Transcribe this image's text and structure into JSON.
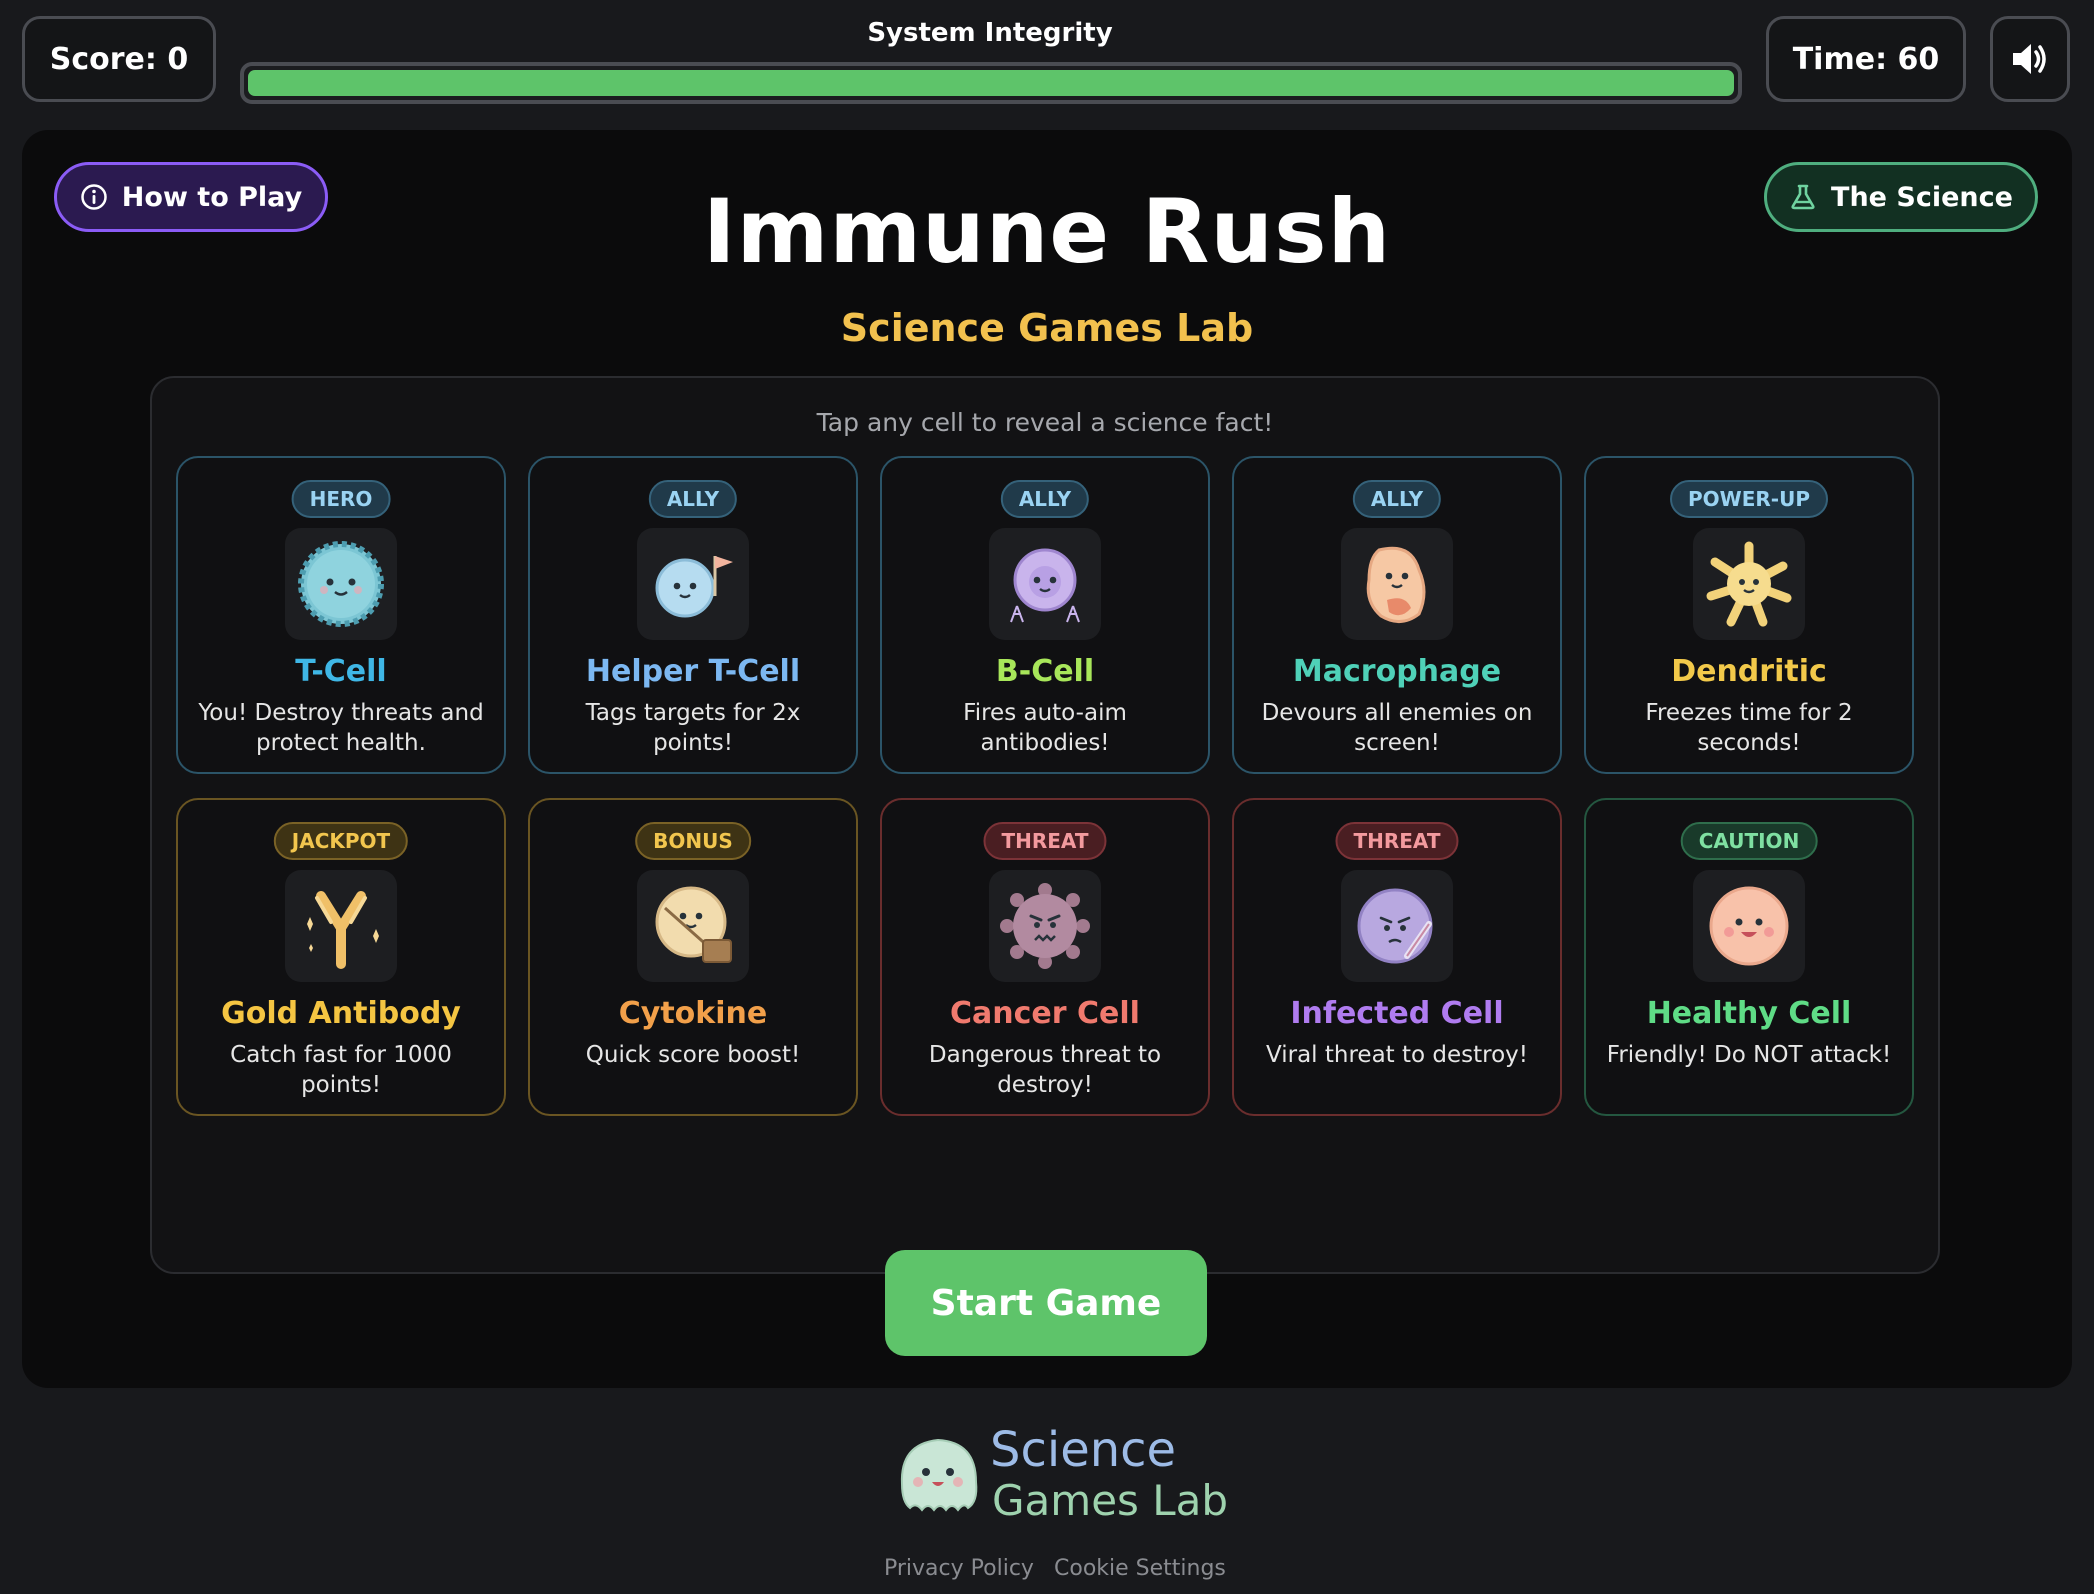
{
  "hud": {
    "score_label": "Score: 0",
    "integrity_label": "System Integrity",
    "integrity_value": 1.0,
    "time_label": "Time: 60",
    "sound_icon": "speaker-icon"
  },
  "header": {
    "how_to_play": "How to Play",
    "the_science": "The Science",
    "title": "Immune Rush",
    "subtitle": "Science Games Lab"
  },
  "grid": {
    "hint": "Tap any cell to reveal a science fact!",
    "cards": [
      {
        "badge": "HERO",
        "name": "T-Cell",
        "desc": "You! Destroy threats and protect health.",
        "name_color": "#3fb7e6"
      },
      {
        "badge": "ALLY",
        "name": "Helper T-Cell",
        "desc": "Tags targets for 2x points!",
        "name_color": "#7cb8f2"
      },
      {
        "badge": "ALLY",
        "name": "B-Cell",
        "desc": "Fires auto-aim antibodies!",
        "name_color": "#a8e65a"
      },
      {
        "badge": "ALLY",
        "name": "Macrophage",
        "desc": "Devours all enemies on screen!",
        "name_color": "#4fd1b8"
      },
      {
        "badge": "POWER-UP",
        "name": "Dendritic",
        "desc": "Freezes time for 2 seconds!",
        "name_color": "#f2c94a"
      },
      {
        "badge": "JACKPOT",
        "name": "Gold Antibody",
        "desc": "Catch fast for 1000 points!",
        "name_color": "#f5c542"
      },
      {
        "badge": "BONUS",
        "name": "Cytokine",
        "desc": "Quick score boost!",
        "name_color": "#f2a04a"
      },
      {
        "badge": "THREAT",
        "name": "Cancer Cell",
        "desc": "Dangerous threat to destroy!",
        "name_color": "#f07a6e"
      },
      {
        "badge": "THREAT",
        "name": "Infected Cell",
        "desc": "Viral threat to destroy!",
        "name_color": "#b07cf0"
      },
      {
        "badge": "CAUTION",
        "name": "Healthy Cell",
        "desc": "Friendly! Do NOT attack!",
        "name_color": "#5fdc86"
      }
    ]
  },
  "start_button": "Start Game",
  "footer": {
    "logo_line1": "Science",
    "logo_line2": "Games Lab",
    "privacy": "Privacy Policy",
    "cookies": "Cookie Settings"
  }
}
